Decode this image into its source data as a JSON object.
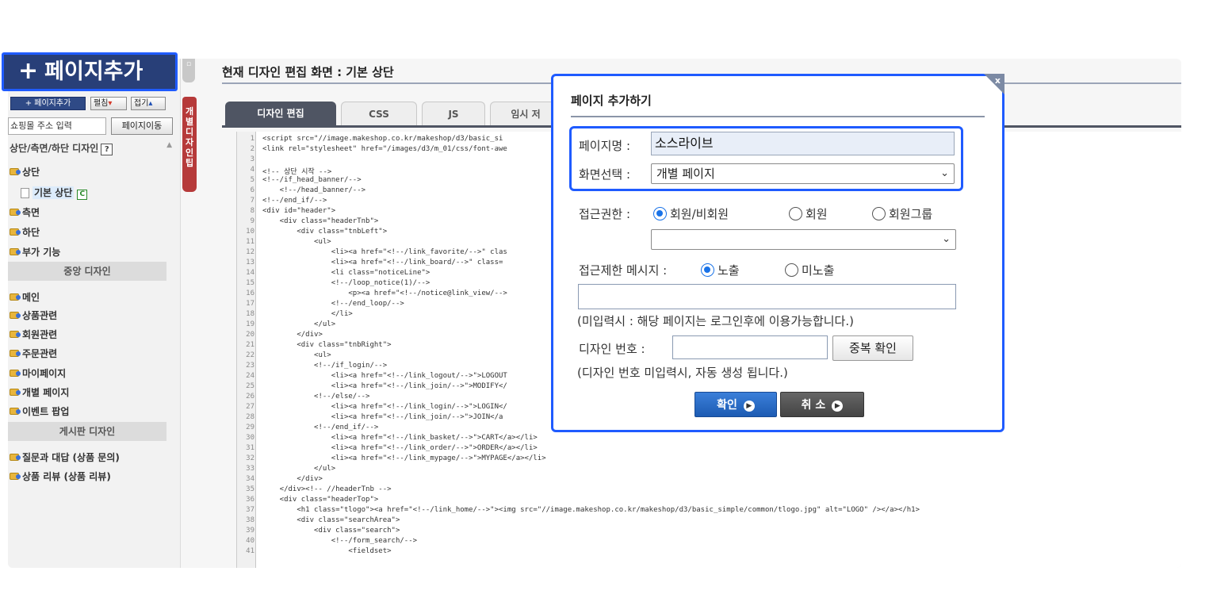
{
  "sidebar": {
    "add_button": "+ 페이지추가",
    "edit_button": "펼침",
    "fold_button": "접기",
    "url_placeholder": "쇼핑몰 주소 입력",
    "move_button": "페이지이동",
    "section_title": "상단/측면/하단 디자인",
    "help_label": "?",
    "tree": {
      "top": "상단",
      "top_child": "기본 상단",
      "top_child_badge": "C",
      "side": "측면",
      "bottom": "하단",
      "extra": "부가 기능"
    },
    "center_header": "중앙 디자인",
    "center_items": [
      "메인",
      "상품관련",
      "회원관련",
      "주문관련",
      "마이페이지",
      "개별 페이지",
      "이벤트 팝업"
    ],
    "board_header": "게시판 디자인",
    "board_items": [
      "질문과 대답 (상품 문의)",
      "상품 리뷰 (상품 리뷰)"
    ],
    "side_tab_label": "개별디자인팁"
  },
  "callout": {
    "plus": "+",
    "label": "페이지추가"
  },
  "editor": {
    "title": "현재 디자인 편집 화면 : 기본 상단",
    "tabs": [
      "디자인 편집",
      "CSS",
      "JS",
      "임시 저"
    ],
    "lines": [
      "<script src=\"//image.makeshop.co.kr/makeshop/d3/basic_si",
      "<link rel=\"stylesheet\" href=\"/images/d3/m_01/css/font-awe",
      "",
      "<!-- 상단 시작 -->",
      "<!--/if_head_banner/-->",
      "    <!--/head_banner/-->",
      "<!--/end_if/-->",
      "<div id=\"header\">",
      "    <div class=\"headerTnb\">",
      "        <div class=\"tnbLeft\">",
      "            <ul>",
      "                <li><a href=\"<!--/link_favorite/-->\" clas",
      "                <li><a href=\"<!--/link_board/-->\" class=",
      "                <li class=\"noticeLine\">",
      "                <!--/loop_notice(1)/-->",
      "                    <p><a href=\"<!--/notice@link_view/-->",
      "                <!--/end_loop/-->",
      "                </li>",
      "            </ul>",
      "        </div>",
      "        <div class=\"tnbRight\">",
      "            <ul>",
      "            <!--/if_login/-->",
      "                <li><a href=\"<!--/link_logout/-->\">LOGOUT",
      "                <li><a href=\"<!--/link_join/-->\">MODIFY</",
      "            <!--/else/-->",
      "                <li><a href=\"<!--/link_login/-->\">LOGIN</",
      "                <li><a href=\"<!--/link_join/-->\">JOIN</a",
      "            <!--/end_if/-->",
      "                <li><a href=\"<!--/link_basket/-->\">CART</a></li>",
      "                <li><a href=\"<!--/link_order/-->\">ORDER</a></li>",
      "                <li><a href=\"<!--/link_mypage/-->\">MYPAGE</a></li>",
      "            </ul>",
      "        </div>",
      "    </div><!-- //headerTnb -->",
      "    <div class=\"headerTop\">",
      "        <h1 class=\"tlogo\"><a href=\"<!--/link_home/-->\"><img src=\"//image.makeshop.co.kr/makeshop/d3/basic_simple/common/tlogo.jpg\" alt=\"LOGO\" /></a></h1>",
      "        <div class=\"searchArea\">",
      "            <div class=\"search\">",
      "                <!--/form_search/-->",
      "                    <fieldset>"
    ]
  },
  "modal": {
    "title": "페이지 추가하기",
    "page_name_label": "페이지명 :",
    "page_name_value": "소스라이브",
    "screen_label": "화면선택 :",
    "screen_value": "개별 페이지",
    "access_label": "접근권한 :",
    "access_options": [
      "회원/비회원",
      "회원",
      "회원그룹"
    ],
    "access_selected": 0,
    "group_select_value": "",
    "restrict_label": "접근제한 메시지 :",
    "restrict_options": [
      "노출",
      "미노출"
    ],
    "restrict_selected": 0,
    "message_value": "",
    "message_hint": "(미입력시 : 해당 페이지는 로그인후에 이용가능합니다.)",
    "design_no_label": "디자인 번호 :",
    "design_no_value": "",
    "dup_button": "중복 확인",
    "design_no_hint": "(디자인 번호 미입력시, 자동 생성 됩니다.)",
    "ok_button": "확인",
    "cancel_button": "취 소",
    "close_icon": "x"
  },
  "colors": {
    "highlight_border": "#1f5bff",
    "sidebar_add_bg": "#283f78",
    "tab_active": "#4f5563",
    "side_tab_red": "#b63a3a",
    "ok_blue": "#1d5bb3"
  }
}
